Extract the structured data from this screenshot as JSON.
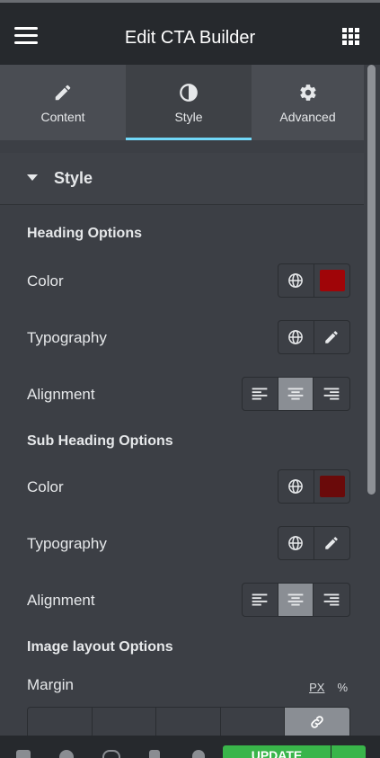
{
  "header": {
    "title": "Edit CTA Builder"
  },
  "tabs": [
    {
      "label": "Content",
      "icon": "pencil-icon"
    },
    {
      "label": "Style",
      "icon": "contrast-icon"
    },
    {
      "label": "Advanced",
      "icon": "gear-icon"
    }
  ],
  "section": {
    "title": "Style"
  },
  "heading_options": {
    "title": "Heading Options",
    "color_label": "Color",
    "color_value": "#a00508",
    "typography_label": "Typography",
    "alignment_label": "Alignment"
  },
  "subheading_options": {
    "title": "Sub Heading Options",
    "color_label": "Color",
    "color_value": "#6a0a0a",
    "typography_label": "Typography",
    "alignment_label": "Alignment"
  },
  "image_layout": {
    "title": "Image layout Options",
    "margin_label": "Margin",
    "unit_px": "PX",
    "unit_pct": "%"
  },
  "footer": {
    "update_label": "UPDATE"
  },
  "colors": {
    "accent": "#71d7f7",
    "update_green": "#39b54a"
  }
}
